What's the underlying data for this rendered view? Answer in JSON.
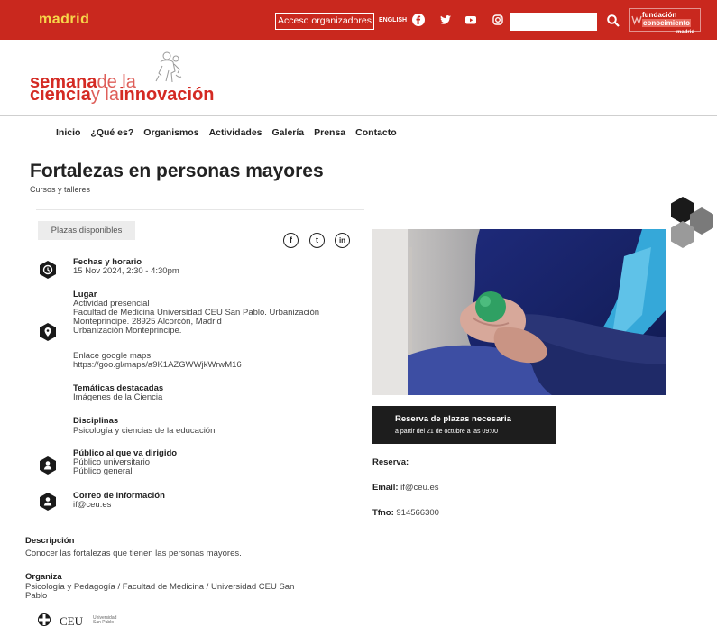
{
  "topbar": {
    "brand": "madrid",
    "access_label": "Acceso organizadores",
    "language": "ENGLISH",
    "search_placeholder": "",
    "foundation_line1": "fundación",
    "foundation_line2": "conocimiento",
    "foundation_line3": "madrid",
    "colors": {
      "bar": "#c9281e",
      "brand": "#f6d64a"
    }
  },
  "site_logo": {
    "word1": "semana",
    "word2": "de la",
    "word3": "ciencia",
    "word4": "y la",
    "word5": "innovación",
    "color": "#d42a23"
  },
  "nav": {
    "items": [
      "Inicio",
      "¿Qué es?",
      "Organismos",
      "Actividades",
      "Galería",
      "Prensa",
      "Contacto"
    ]
  },
  "page": {
    "title": "Fortalezas en personas mayores",
    "category": "Cursos y talleres",
    "availability_badge": "Plazas disponibles"
  },
  "share": {
    "facebook": "f",
    "twitter": "t",
    "linkedin": "in"
  },
  "info": {
    "dates_title": "Fechas y horario",
    "dates_value": "15 Nov 2024, 2:30 - 4:30pm",
    "place_title": "Lugar",
    "place_line1": "Actividad presencial",
    "place_line2": "Facultad de Medicina Universidad CEU San Pablo. Urbanización",
    "place_line3": "Monteprincipe. 28925 Alcorcón, Madrid",
    "place_line4": "Urbanización Monteprincipe.",
    "maps_label": "Enlace google maps:",
    "maps_url": "https://goo.gl/maps/a9K1AZGWWjkWrwM16",
    "themes_title": "Temáticas destacadas",
    "themes_value": "Imágenes de la Ciencia",
    "disciplines_title": "Disciplinas",
    "disciplines_value": "Psicología y ciencias de la educación",
    "audience_title": "Público al que va dirigido",
    "audience_line1": "Público universitario",
    "audience_line2": "Público general",
    "email_title": "Correo de información",
    "email_value": "if@ceu.es"
  },
  "description": {
    "title": "Descripción",
    "text": "Conocer las fortalezas que tienen las personas mayores.",
    "org_title": "Organiza",
    "org_line1": "Psicología y Pedagogía / Facultad de Medicina / Universidad CEU San",
    "org_line2": "Pablo"
  },
  "ceu_logo": {
    "text": "CEU",
    "small1": "Universidad",
    "small2": "San Pablo"
  },
  "reservation": {
    "box_title": "Reserva de plazas necesaria",
    "box_sub": "a partir del 21 de octubre a las 09:00",
    "reserva_label": "Reserva:",
    "email_label": "Email:",
    "email_value": "if@ceu.es",
    "phone_label": "Tfno:",
    "phone_value": "914566300"
  }
}
